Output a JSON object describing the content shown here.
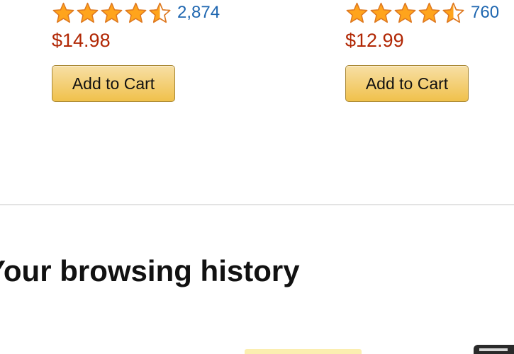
{
  "products": [
    {
      "rating_stars": 4.5,
      "rating_count": "2,874",
      "price": "$14.98",
      "button_label": "Add to Cart"
    },
    {
      "rating_stars": 4.5,
      "rating_count": "760",
      "price": "$12.99",
      "button_label": "Add to Cart"
    }
  ],
  "browsing_history": {
    "heading": "Your browsing history"
  },
  "colors": {
    "star_fill": "#ffa41c",
    "star_stroke": "#de7921",
    "link": "#1e66b0",
    "price": "#b12704",
    "button_top": "#f7dfa5",
    "button_bottom": "#f0c14b",
    "button_border": "#a88734"
  },
  "icons": {
    "star_full": "star-icon",
    "star_half": "star-half-icon"
  }
}
